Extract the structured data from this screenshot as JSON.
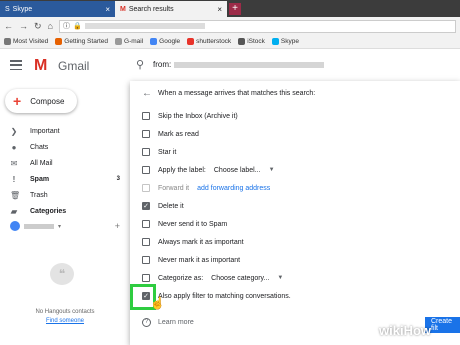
{
  "browser": {
    "tabs": [
      {
        "label": "Skype",
        "active": false
      },
      {
        "label": "Search results",
        "active": true
      }
    ],
    "bookmarks": [
      "Most Visited",
      "Getting Started",
      "G-mail",
      "Google",
      "shutterstock",
      "iStock",
      "Skype"
    ]
  },
  "gmail": {
    "logo_letter": "M",
    "logo_text": "Gmail",
    "search_prefix": "from:"
  },
  "sidebar": {
    "compose": "Compose",
    "items": [
      {
        "label": "Important",
        "icon": "important-icon",
        "glyph": "❯"
      },
      {
        "label": "Chats",
        "icon": "chat-icon",
        "glyph": "●"
      },
      {
        "label": "All Mail",
        "icon": "mail-icon",
        "glyph": "✉"
      },
      {
        "label": "Spam",
        "icon": "spam-icon",
        "glyph": "!",
        "count": "3",
        "bold": true
      },
      {
        "label": "Trash",
        "icon": "trash-icon",
        "glyph": "🗑"
      },
      {
        "label": "Categories",
        "icon": "label-icon",
        "glyph": "▰",
        "bold": true
      }
    ],
    "no_contacts": "No Hangouts contacts",
    "find_someone": "Find someone"
  },
  "filter_panel": {
    "title": "When a message arrives that matches this search:",
    "options": [
      {
        "label": "Skip the Inbox (Archive it)",
        "checked": false
      },
      {
        "label": "Mark as read",
        "checked": false
      },
      {
        "label": "Star it",
        "checked": false
      },
      {
        "label": "Apply the label:",
        "checked": false,
        "select": "Choose label..."
      },
      {
        "label": "Forward it",
        "checked": false,
        "disabled": true,
        "link": "add forwarding address"
      },
      {
        "label": "Delete it",
        "checked": true
      },
      {
        "label": "Never send it to Spam",
        "checked": false
      },
      {
        "label": "Always mark it as important",
        "checked": false
      },
      {
        "label": "Never mark it as important",
        "checked": false
      },
      {
        "label": "Categorize as:",
        "checked": false,
        "select": "Choose category..."
      },
      {
        "label": "Also apply filter to matching conversations.",
        "checked": true
      }
    ],
    "learn_more": "Learn more",
    "create_button": "Create filt"
  },
  "watermark": "wikiHow",
  "colors": {
    "gmail_red": "#d93025",
    "link_blue": "#1a73e8",
    "highlight_green": "#2ecc40"
  }
}
